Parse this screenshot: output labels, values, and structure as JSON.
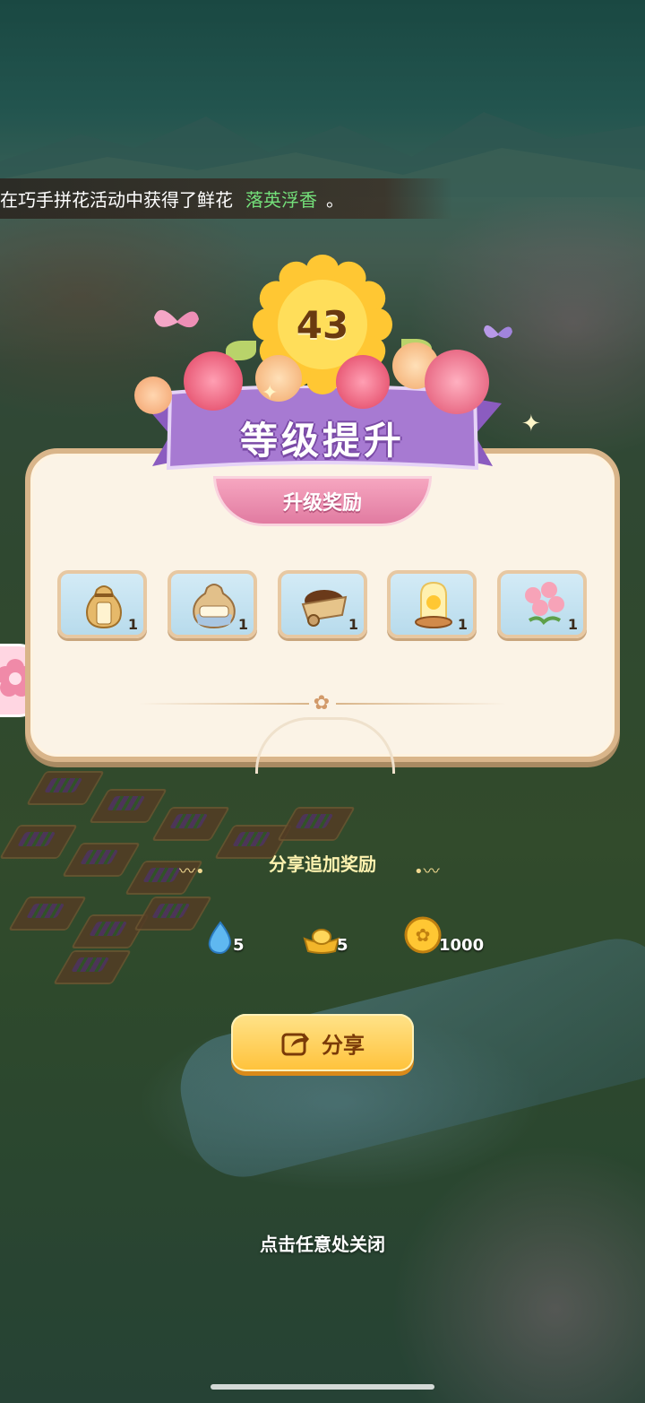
{
  "notification": {
    "text": "在巧手拼花活动中获得了鲜花",
    "flower_name": "落英浮香",
    "suffix": "。"
  },
  "level_up": {
    "level": "43",
    "title": "等级提升",
    "rewards_label": "升级奖励",
    "rewards": [
      {
        "name": "硫磺剂",
        "icon": "sulfur-sack-icon",
        "count": "1"
      },
      {
        "name": "贝壳粉",
        "icon": "shell-powder-sack-icon",
        "count": "1"
      },
      {
        "name": "泥炭土",
        "icon": "peat-soil-cart-icon",
        "count": "1"
      },
      {
        "name": "",
        "icon": "sun-jar-icon",
        "count": "1"
      },
      {
        "name": "",
        "icon": "pink-roses-icon",
        "count": "1"
      }
    ]
  },
  "share": {
    "title": "分享追加奖励",
    "rewards": [
      {
        "icon": "water-drop-icon",
        "amount": "5"
      },
      {
        "icon": "gold-ingot-icon",
        "amount": "5"
      },
      {
        "icon": "gold-coin-icon",
        "amount": "1000"
      }
    ],
    "button_label": "分享"
  },
  "close_hint": "点击任意处关闭",
  "colors": {
    "flower_name": "#74e07a",
    "ribbon": "#a77ad2",
    "button": "#ffc23a",
    "panel": "#fbf3e6"
  }
}
